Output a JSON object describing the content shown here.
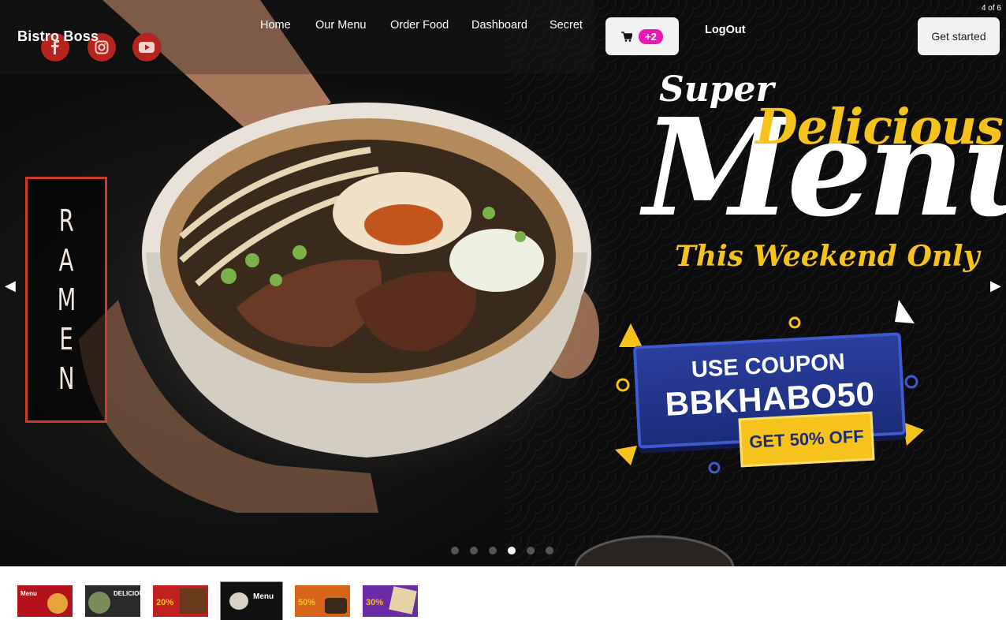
{
  "nav": {
    "brand": "Bistro Boss",
    "links": [
      "Home",
      "Our Menu",
      "Order Food",
      "Dashboard",
      "Secret"
    ],
    "cart_badge": "+2",
    "logout": "LogOut",
    "cta": "Get started",
    "social_icons": [
      "facebook-icon",
      "instagram-icon",
      "youtube-icon"
    ]
  },
  "carousel": {
    "counter": "4 of 6",
    "current_slide": 4,
    "total_slides": 6,
    "slide": {
      "side_label": [
        "R",
        "A",
        "M",
        "E",
        "N"
      ],
      "super": "Super",
      "delicious": "Delicious",
      "menu": "Menu",
      "weekend": "This Weekend Only",
      "use_coupon": "USE COUPON",
      "code": "BBKHABO50",
      "offer": "GET 50% OFF"
    },
    "thumbnails": [
      {
        "text": "Menu",
        "bg": "#b3121a"
      },
      {
        "text": "DELICIOUS",
        "bg": "#2a2a2a"
      },
      {
        "text": "20%",
        "bg": "#c0211e"
      },
      {
        "text": "Menu",
        "bg": "#111111"
      },
      {
        "text": "50%",
        "bg": "#d8641a"
      },
      {
        "text": "30%",
        "bg": "#6b2aa6"
      }
    ]
  },
  "colors": {
    "accent_red": "#b7241d",
    "badge_pink": "#e81ab3",
    "promo_yellow": "#f6c21c",
    "coupon_blue": "#1b2c7a"
  }
}
